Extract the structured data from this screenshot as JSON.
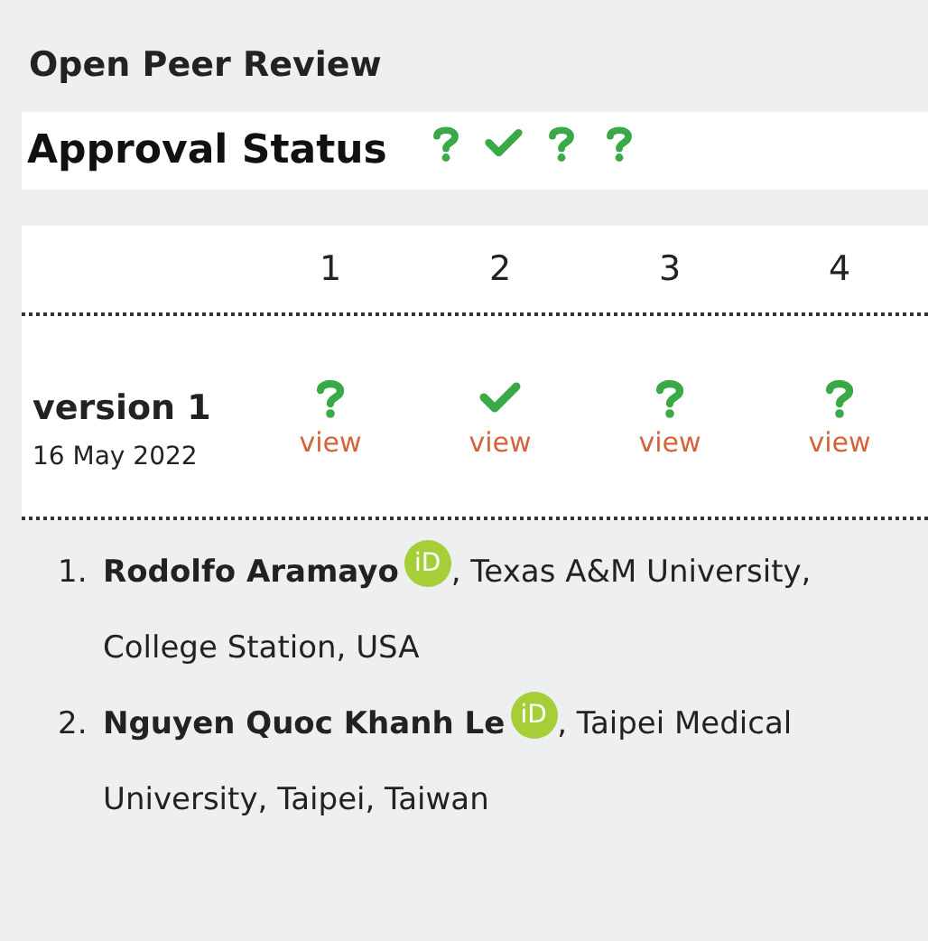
{
  "title": "Open Peer Review",
  "approval": {
    "label": "Approval Status",
    "statuses": [
      {
        "kind": "pending"
      },
      {
        "kind": "approved"
      },
      {
        "kind": "pending"
      },
      {
        "kind": "pending"
      }
    ]
  },
  "table": {
    "columns": [
      "1",
      "2",
      "3",
      "4"
    ],
    "rows": [
      {
        "version": "version 1",
        "date": "16 May 2022",
        "reports": [
          {
            "kind": "pending",
            "link": "view"
          },
          {
            "kind": "approved",
            "link": "view"
          },
          {
            "kind": "pending",
            "link": "view"
          },
          {
            "kind": "pending",
            "link": "view"
          }
        ]
      }
    ]
  },
  "reviewers": [
    {
      "number": "1.",
      "name": "Rodolfo Aramayo",
      "orcid": "iD",
      "affiliation_lines": [
        ", Texas A&M University,",
        "College Station, USA"
      ]
    },
    {
      "number": "2.",
      "name": "Nguyen Quoc Khanh Le",
      "orcid": "iD",
      "affiliation_lines": [
        ", Taipei Medical",
        "University, Taipei, Taiwan"
      ]
    }
  ]
}
